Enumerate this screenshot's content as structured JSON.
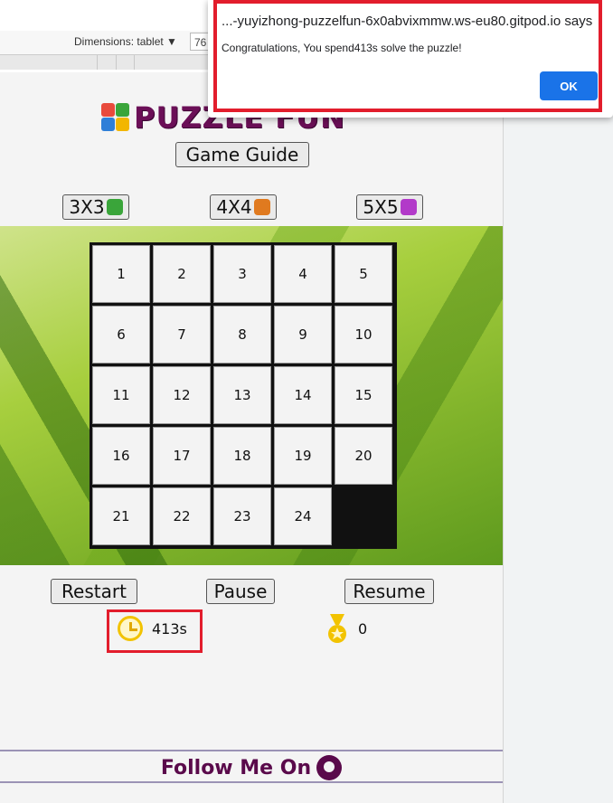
{
  "devtools": {
    "dimensions_label": "Dimensions: tablet ▼",
    "width_value": "76"
  },
  "page": {
    "logo_text": "PUZZLE FUN",
    "game_guide_label": "Game Guide",
    "size_buttons": [
      {
        "label": "3X3",
        "piece_color": "#3aa53a"
      },
      {
        "label": "4X4",
        "piece_color": "#e07a1f"
      },
      {
        "label": "5X5",
        "piece_color": "#b23ac9"
      }
    ],
    "tiles": [
      "1",
      "2",
      "3",
      "4",
      "5",
      "6",
      "7",
      "8",
      "9",
      "10",
      "11",
      "12",
      "13",
      "14",
      "15",
      "16",
      "17",
      "18",
      "19",
      "20",
      "21",
      "22",
      "23",
      "24",
      ""
    ],
    "controls": {
      "restart_label": "Restart",
      "pause_label": "Pause",
      "resume_label": "Resume"
    },
    "stats": {
      "timer": "413s",
      "timer_icon": "clock-icon",
      "moves": "0",
      "moves_icon": "medal-icon"
    },
    "footer": {
      "text": "Follow Me On",
      "icon": "github-icon"
    }
  },
  "dialog": {
    "title": "...-yuyizhong-puzzelfun-6x0abvixmmw.ws-eu80.gitpod.io says",
    "message": "Congratulations, You spend413s solve the puzzle!",
    "ok_label": "OK"
  },
  "colors": {
    "brand": "#6b0f57",
    "highlight": "#e21d2c",
    "ok_button": "#1a73e8"
  }
}
